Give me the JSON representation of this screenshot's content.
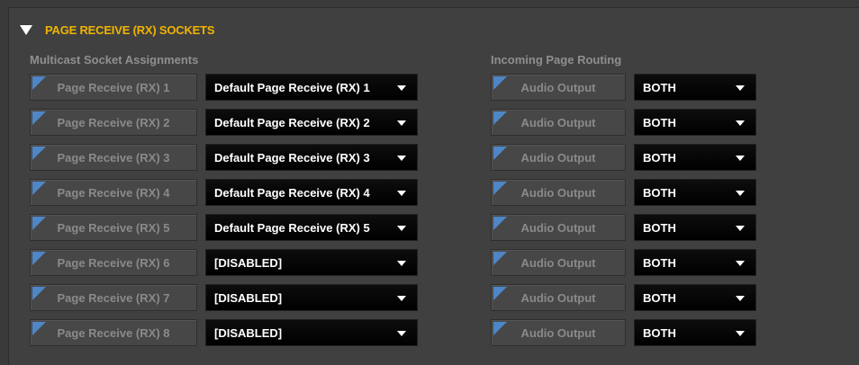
{
  "section": {
    "title": "PAGE RECEIVE (RX) SOCKETS"
  },
  "multicast": {
    "heading": "Multicast Socket Assignments",
    "rows": [
      {
        "label": "Page Receive (RX) 1",
        "value": "Default Page Receive (RX) 1"
      },
      {
        "label": "Page Receive (RX) 2",
        "value": "Default Page Receive (RX) 2"
      },
      {
        "label": "Page Receive (RX) 3",
        "value": "Default Page Receive (RX) 3"
      },
      {
        "label": "Page Receive (RX) 4",
        "value": "Default Page Receive (RX) 4"
      },
      {
        "label": "Page Receive (RX) 5",
        "value": "Default Page Receive (RX) 5"
      },
      {
        "label": "Page Receive (RX) 6",
        "value": "[DISABLED]"
      },
      {
        "label": "Page Receive (RX) 7",
        "value": "[DISABLED]"
      },
      {
        "label": "Page Receive (RX) 8",
        "value": "[DISABLED]"
      }
    ]
  },
  "routing": {
    "heading": "Incoming Page Routing",
    "rows": [
      {
        "label": "Audio Output",
        "value": "BOTH"
      },
      {
        "label": "Audio Output",
        "value": "BOTH"
      },
      {
        "label": "Audio Output",
        "value": "BOTH"
      },
      {
        "label": "Audio Output",
        "value": "BOTH"
      },
      {
        "label": "Audio Output",
        "value": "BOTH"
      },
      {
        "label": "Audio Output",
        "value": "BOTH"
      },
      {
        "label": "Audio Output",
        "value": "BOTH"
      },
      {
        "label": "Audio Output",
        "value": "BOTH"
      }
    ]
  },
  "colors": {
    "title_accent": "#f0b400",
    "corner_marker": "#4f86c6",
    "dropdown_bg": "#000000"
  }
}
